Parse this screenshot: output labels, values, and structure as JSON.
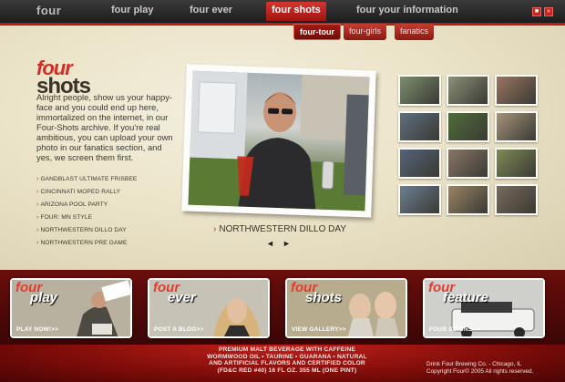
{
  "nav": {
    "logo": "four",
    "items": [
      "four play",
      "four ever",
      "four shots",
      "four your information"
    ],
    "active_index": 2,
    "controls": [
      "■",
      "»"
    ]
  },
  "subnav": {
    "items": [
      "four-tour",
      "four-girls",
      "fanatics"
    ],
    "active_index": 0
  },
  "section": {
    "logo_line1": "four",
    "logo_line2": "shots",
    "intro": "Alright people, show us your happy-face and you could end up here, immortalized on the internet, in our Four-Shots archive. If you're real ambitious, you can upload your own photo in our fanatics section, and yes, we screen them first."
  },
  "events": [
    "GANDBLAST ULTIMATE FRISBEE",
    "CINCINNATI MOPED RALLY",
    "ARIZONA POOL PARTY",
    "FOUR: MN STYLE",
    "NORTHWESTERN DILLO DAY",
    "NORTHWESTERN PRE GAME"
  ],
  "featured_photo": {
    "caption": "NORTHWESTERN DILLO DAY",
    "prev": "◄",
    "next": "►"
  },
  "thumbnails": [
    {
      "color": "#7d8f6e"
    },
    {
      "color": "#8c8f77"
    },
    {
      "color": "#9a7560"
    },
    {
      "color": "#5e6f7d"
    },
    {
      "color": "#4f6d3a"
    },
    {
      "color": "#a6937a"
    },
    {
      "color": "#556378"
    },
    {
      "color": "#8a7766"
    },
    {
      "color": "#7f8a55"
    },
    {
      "color": "#6d7f93"
    },
    {
      "color": "#9b8466"
    },
    {
      "color": "#7a6a5d"
    }
  ],
  "features": [
    {
      "line1": "four",
      "line2": "play",
      "cta": "PLAY NOW!>>",
      "bg": "#b9b1a0"
    },
    {
      "line1": "four",
      "line2": "ever",
      "cta": "POST A BLOG>>",
      "bg": "#c7c2b6"
    },
    {
      "line1": "four",
      "line2": "shots",
      "cta": "VIEW GALLERY>>",
      "bg": "#b8ac8e"
    },
    {
      "line1": "four",
      "line2": "feature",
      "cta": "FOUR SCIONS>>",
      "bg": "#cfcfcb"
    }
  ],
  "footer": {
    "legal_1": "PREMIUM MALT BEVERAGE WITH CAFFEINE",
    "legal_2": "WORMWOOD OIL • TAURINE • GUARANA • NATURAL",
    "legal_3": "AND ARTIFICIAL FLAVORS AND CERTIFIED COLOR",
    "legal_4": "(FD&C RED #40) 16 FL OZ. 355 ML (ONE PINT)",
    "company": "Drink Four Brewing Co. - Chicago, IL",
    "copyright": "Copyright Four© 2005 All rights reserved."
  },
  "colors": {
    "brand_red": "#c8231d",
    "dark_red": "#6a0e0b",
    "cream": "#ece4c9"
  }
}
